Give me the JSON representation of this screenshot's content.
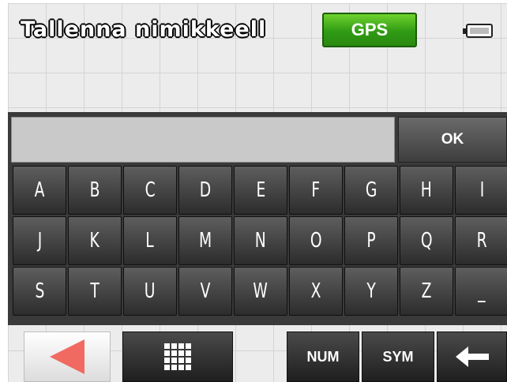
{
  "header": {
    "title": "Tallenna nimikkeell",
    "gps_label": "GPS",
    "battery_icon": "battery-icon"
  },
  "keyboard": {
    "input_value": "",
    "ok_label": "OK",
    "rows": [
      [
        "A",
        "B",
        "C",
        "D",
        "E",
        "F",
        "G",
        "H",
        "I"
      ],
      [
        "J",
        "K",
        "L",
        "M",
        "N",
        "O",
        "P",
        "Q",
        "R"
      ],
      [
        "S",
        "T",
        "U",
        "V",
        "W",
        "X",
        "Y",
        "Z",
        "_"
      ]
    ]
  },
  "toolbar": {
    "back_icon": "triangle-left-icon",
    "layout_icon": "keypad-grid-icon",
    "num_label": "NUM",
    "sym_label": "SYM",
    "backspace_icon": "arrow-left-icon"
  },
  "colors": {
    "gps_green": "#3aa81a",
    "back_arrow": "#f06a62",
    "key_bg": "#3a3a3a"
  }
}
